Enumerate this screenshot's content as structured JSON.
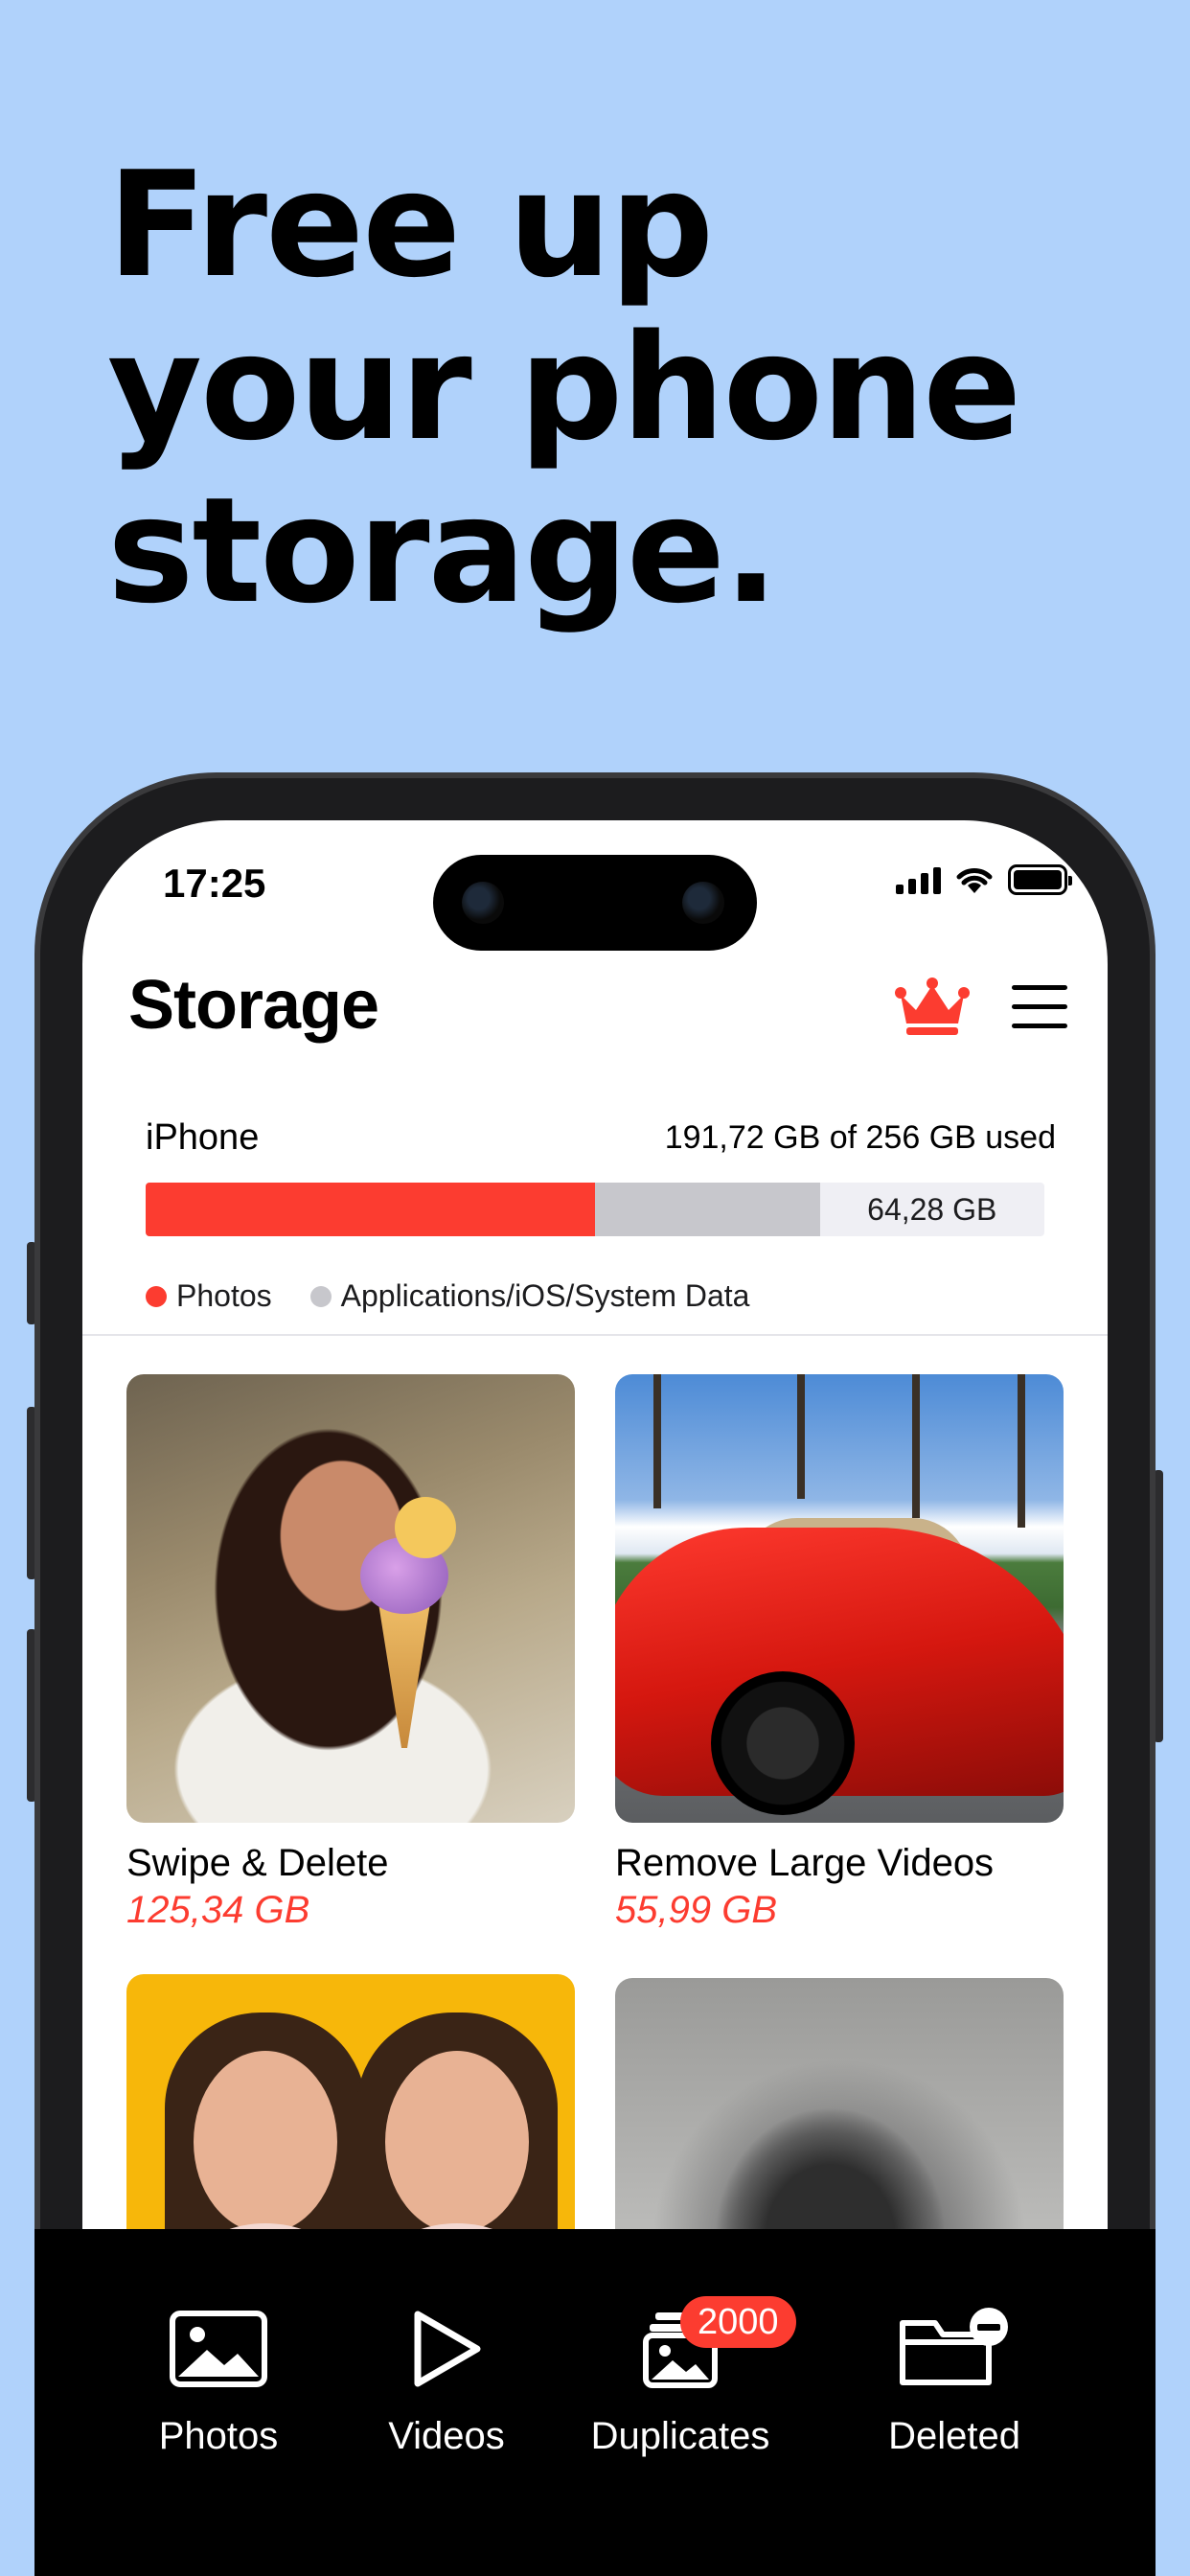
{
  "headline": [
    "Free up",
    "your phone",
    "storage."
  ],
  "status_bar": {
    "time": "17:25"
  },
  "header": {
    "title": "Storage"
  },
  "storage": {
    "device": "iPhone",
    "used_text": "191,72 GB of 256 GB used",
    "free_text": "64,28 GB",
    "photos_fraction": 0.5,
    "system_fraction": 0.25,
    "legend": [
      {
        "label": "Photos",
        "color": "#fc3c30"
      },
      {
        "label": "Applications/iOS/System Data",
        "color": "#c7c7cc"
      }
    ]
  },
  "cards": [
    {
      "title": "Swipe & Delete",
      "size": "125,34 GB"
    },
    {
      "title": "Remove Large Videos",
      "size": "55,99 GB"
    }
  ],
  "tabs": [
    {
      "label": "Photos",
      "icon": "photo-icon"
    },
    {
      "label": "Videos",
      "icon": "play-icon"
    },
    {
      "label": "Duplicates",
      "icon": "duplicates-icon",
      "badge": "2000"
    },
    {
      "label": "Deleted",
      "icon": "deleted-folder-icon"
    }
  ],
  "colors": {
    "accent": "#fc3c30",
    "background": "#b0d2fb"
  }
}
